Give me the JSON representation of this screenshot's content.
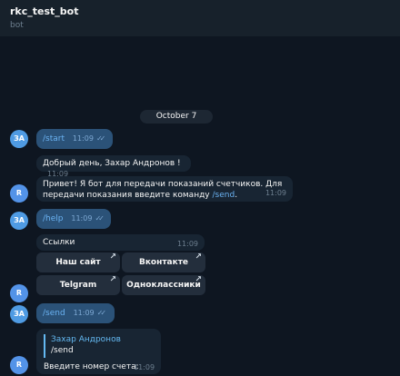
{
  "header": {
    "title": "rkc_test_bot",
    "subtitle": "bot"
  },
  "chat": {
    "date": "October 7",
    "user_avatar": "ЗА",
    "bot_avatar": "R",
    "messages": {
      "m1": {
        "text": "/start",
        "time": "11:09",
        "read": true
      },
      "m2": {
        "text": "Добрый день, Захар Андронов !",
        "time": "11:09"
      },
      "m3": {
        "line1": "Привет! Я бот для передачи показаний счетчиков. Для",
        "line2_pre": "передачи показания введите команду ",
        "line2_cmd": "/send",
        "line2_post": ".",
        "time": "11:09"
      },
      "m4": {
        "text": "/help",
        "time": "11:09",
        "read": true
      },
      "m5": {
        "text": "Ссылки",
        "time": "11:09"
      },
      "m6": {
        "text": "/send",
        "time": "11:09",
        "read": true
      },
      "m7": {
        "reply_name": "Захар Андронов",
        "reply_text": "/send",
        "text": "Введите номер счета:",
        "time": "11:09"
      }
    },
    "keyboard": {
      "our_site": "Наш сайт",
      "vkontakte": "Вконтакте",
      "telegram": "Telgram",
      "odnoklassniki": "Одноклассники"
    },
    "checks_glyph": "✓✓",
    "arrow_glyph": "↗"
  },
  "colors": {
    "background": "#0e1621",
    "header": "#17212b",
    "incoming_bubble": "#182533",
    "outgoing_bubble": "#2b5278",
    "command_link": "#6ab2f2",
    "avatar": "#4f9be3"
  }
}
